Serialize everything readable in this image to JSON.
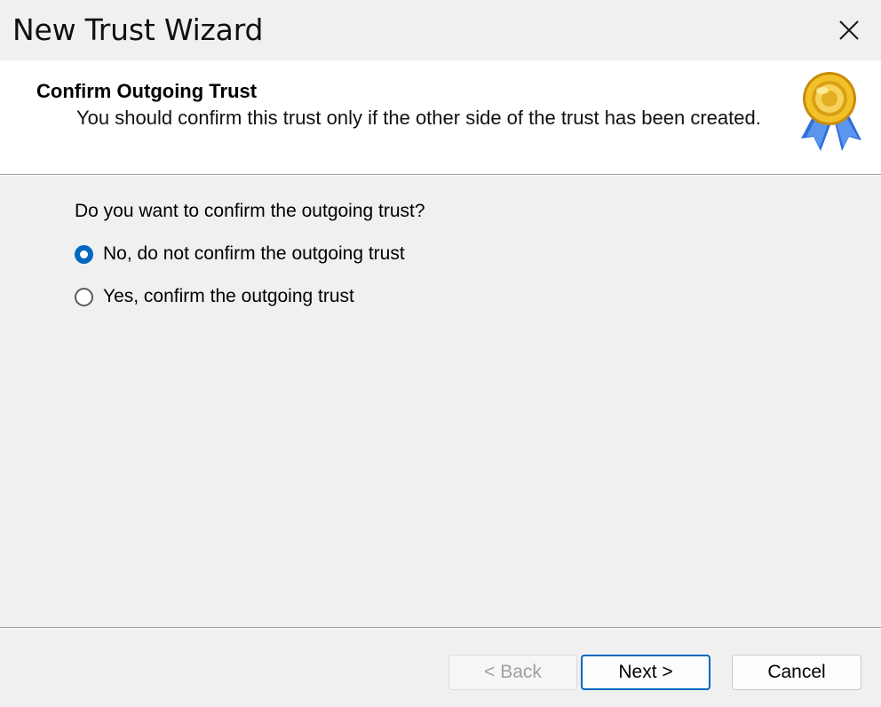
{
  "window": {
    "title": "New Trust Wizard",
    "close_icon": "close-icon"
  },
  "header": {
    "title": "Confirm Outgoing Trust",
    "subtitle": "You should confirm this trust only if the other side of the trust has been created.",
    "icon": "award-medal-icon"
  },
  "content": {
    "question": "Do you want to confirm the outgoing trust?",
    "options": [
      {
        "label": "No, do not confirm the outgoing trust",
        "selected": true
      },
      {
        "label": "Yes, confirm the outgoing trust",
        "selected": false
      }
    ]
  },
  "footer": {
    "back_label": "< Back",
    "back_enabled": false,
    "next_label": "Next >",
    "cancel_label": "Cancel"
  },
  "colors": {
    "accent": "#0067c0",
    "window_bg": "#f0f0f0",
    "header_bg": "#ffffff",
    "medal_gold": "#e8b018",
    "ribbon_blue": "#2f6fd6"
  }
}
